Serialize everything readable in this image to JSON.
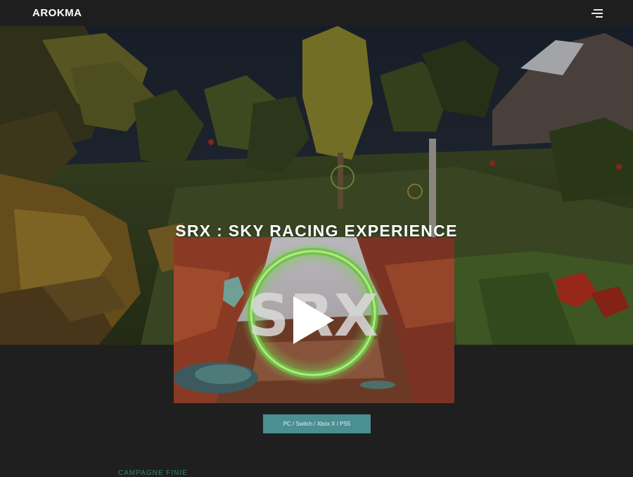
{
  "header": {
    "brand": "AROKMA",
    "menu_icon": "hamburger-menu-icon"
  },
  "hero": {
    "title": "SRX : SKY RACING EXPERIENCE"
  },
  "video": {
    "logo_text": "SRX",
    "play_icon": "play-icon"
  },
  "platforms": {
    "label": "PC / Switch / Xbox X / PS5"
  },
  "campaign": {
    "status": "CAMPAGNE FINIE"
  },
  "colors": {
    "background": "#1f1f1f",
    "accent": "#4a8f92",
    "campaign_text": "#3d7d74"
  }
}
